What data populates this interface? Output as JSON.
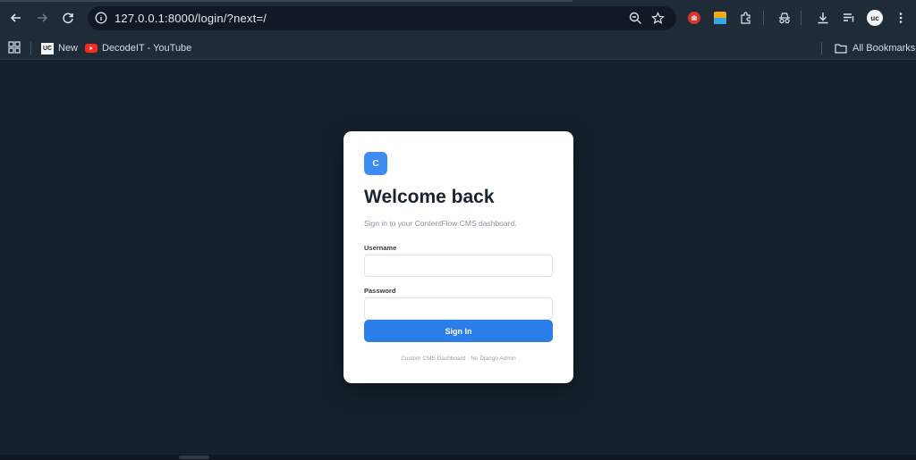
{
  "browser": {
    "url": "127.0.0.1:8000/login/?next=/",
    "bookmarks": [
      {
        "label": "New",
        "icon": "uc-icon"
      },
      {
        "label": "DecodeIT - YouTube",
        "icon": "youtube-icon"
      }
    ],
    "all_bookmarks": "All Bookmarks"
  },
  "login": {
    "logo_letter": "C",
    "title": "Welcome back",
    "subtitle": "Sign in to your ContentFlow CMS dashboard.",
    "username_label": "Username",
    "username_value": "",
    "password_label": "Password",
    "password_value": "",
    "submit_label": "Sign In",
    "footer": "Custom CMS Dashboard · No Django Admin"
  },
  "colors": {
    "page_bg": "#15202b",
    "accent": "#2b7de9",
    "logo": "#3f8cf0"
  }
}
